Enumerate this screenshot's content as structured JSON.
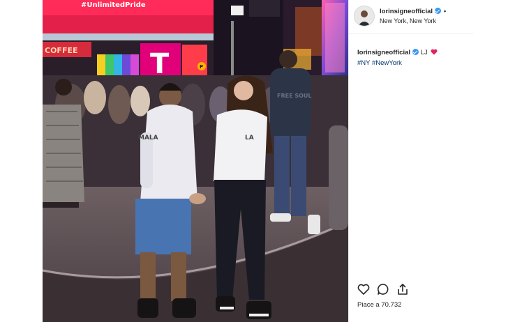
{
  "photo": {
    "billboard_text": "#UnlimitedPride",
    "store_sign": "COFFEE",
    "brand_logo": "T",
    "hoodie_text_left": "MALA",
    "hoodie_text_right": "LA",
    "shirt_text": "FREE SOUL",
    "signal_letter": "P"
  },
  "header": {
    "username": "lorinsigneofficial",
    "location": "New York, New York",
    "more_glyph": "•"
  },
  "caption": {
    "username": "lorinsigneofficial",
    "text": "LJ",
    "hashtags": "#NY #NewYork"
  },
  "actions": {
    "like_icon": "heart-icon",
    "comment_icon": "comment-icon",
    "share_icon": "share-icon"
  },
  "likes_text": "Piace a 70.732",
  "colors": {
    "verified": "#3897f0",
    "hashtag": "#003569",
    "emoji_heart": "#e0245e"
  }
}
